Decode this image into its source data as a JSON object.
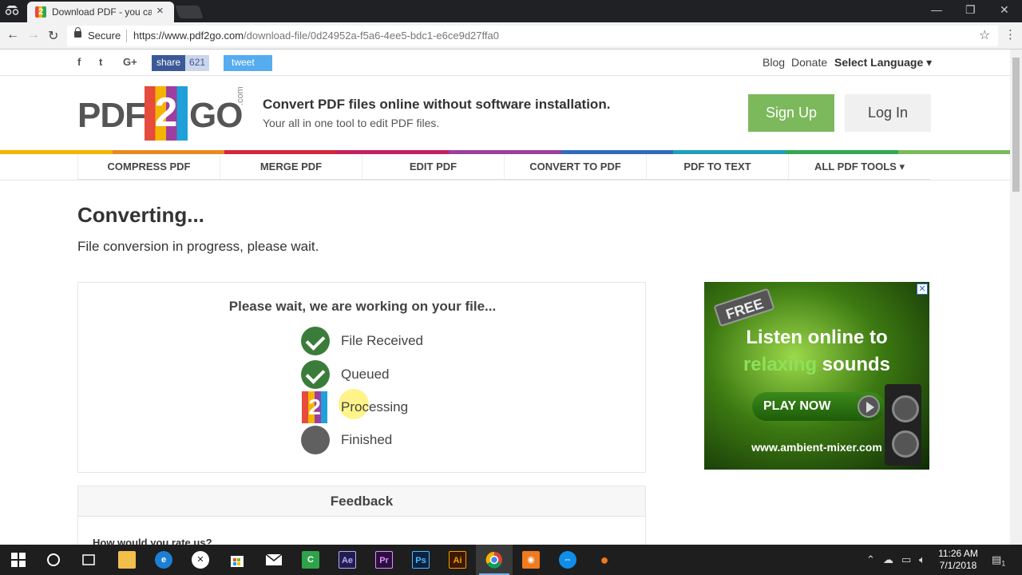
{
  "browser": {
    "tab_title": "Download PDF - you can",
    "tab_favicon": "2",
    "secure_label": "Secure",
    "url_host": "https://www.pdf2go.com",
    "url_path": "/download-file/0d24952a-f5a6-4ee5-bdc1-e6ce9d27ffa0"
  },
  "topbar": {
    "social": [
      "f",
      "t",
      "G+"
    ],
    "fb_share_label": "share",
    "fb_share_count": "621",
    "tweet_label": "tweet",
    "links": [
      "Blog",
      "Donate"
    ],
    "language_label": "Select Language ▾"
  },
  "header": {
    "logo_pdf": "PDF",
    "logo_two": "2",
    "logo_go": "GO",
    "logo_com": ".com",
    "tagline": "Convert PDF files online without software installation.",
    "subtagline": "Your all in one tool to edit PDF files.",
    "signup_label": "Sign Up",
    "login_label": "Log In"
  },
  "colors": {
    "accent_bar": [
      "#f5b400",
      "#e8891f",
      "#d6263b",
      "#c4215e",
      "#9c3fa0",
      "#2f6bbf",
      "#1fa0b8",
      "#33a852",
      "#7cb85c"
    ],
    "signup": "#7cb85c",
    "check": "#3a7d3a"
  },
  "nav": [
    "COMPRESS PDF",
    "MERGE PDF",
    "EDIT PDF",
    "CONVERT TO PDF",
    "PDF TO TEXT",
    "ALL PDF TOOLS ▾"
  ],
  "main": {
    "title": "Converting...",
    "lead": "File conversion in progress, please wait.",
    "card_title": "Please wait, we are working on your file...",
    "steps": [
      {
        "label": "File Received",
        "status": "done",
        "icon": "check-icon"
      },
      {
        "label": "Queued",
        "status": "done",
        "icon": "check-icon"
      },
      {
        "label": "Processing",
        "status": "active",
        "icon": "pdf2go-logo-icon"
      },
      {
        "label": "Finished",
        "status": "pending",
        "icon": "pending-dot-icon"
      }
    ],
    "feedback_title": "Feedback",
    "feedback_question": "How would you rate us?"
  },
  "ad": {
    "badge": "FREE",
    "line1": "Listen online to",
    "line2_highlight": "relaxing",
    "line2_rest": " sounds",
    "play_label": "PLAY NOW",
    "url": "www.ambient-mixer.com",
    "close": "✕"
  },
  "taskbar": {
    "apps": [
      "windows-start-icon",
      "cortana-icon",
      "task-view-icon",
      "file-explorer-icon",
      "edge-icon",
      "xbox-icon",
      "store-icon",
      "mail-icon",
      "camtasia-icon",
      "after-effects-icon",
      "premiere-icon",
      "photoshop-icon",
      "illustrator-icon",
      "chrome-icon",
      "app-orange-icon",
      "teamviewer-icon",
      "recorder-icon"
    ],
    "labels": {
      "ae": "Ae",
      "pr": "Pr",
      "ps": "Ps",
      "ai": "Ai"
    },
    "time": "11:26 AM",
    "date": "7/1/2018",
    "notification_count": "1"
  }
}
